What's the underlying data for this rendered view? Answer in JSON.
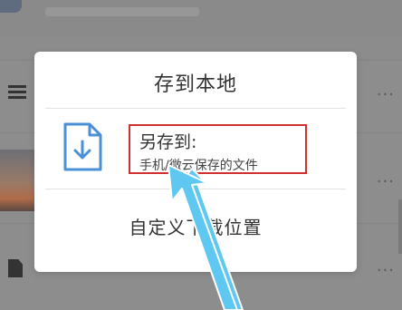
{
  "dialog": {
    "title": "存到本地",
    "save_option": {
      "title": "另存到:",
      "subtitle": "手机/微云保存的文件",
      "icon": "download-file-icon"
    },
    "custom_location_label": "自定义下载位置"
  },
  "background": {
    "row_menu_icon": "more-horizontal-icon"
  },
  "annotation": {
    "highlight_color": "#d0312d",
    "arrow_color": "#5ec8f0"
  },
  "colors": {
    "icon_blue": "#4a90d9",
    "dialog_bg": "#ffffff",
    "overlay": "#8c8c8c"
  }
}
